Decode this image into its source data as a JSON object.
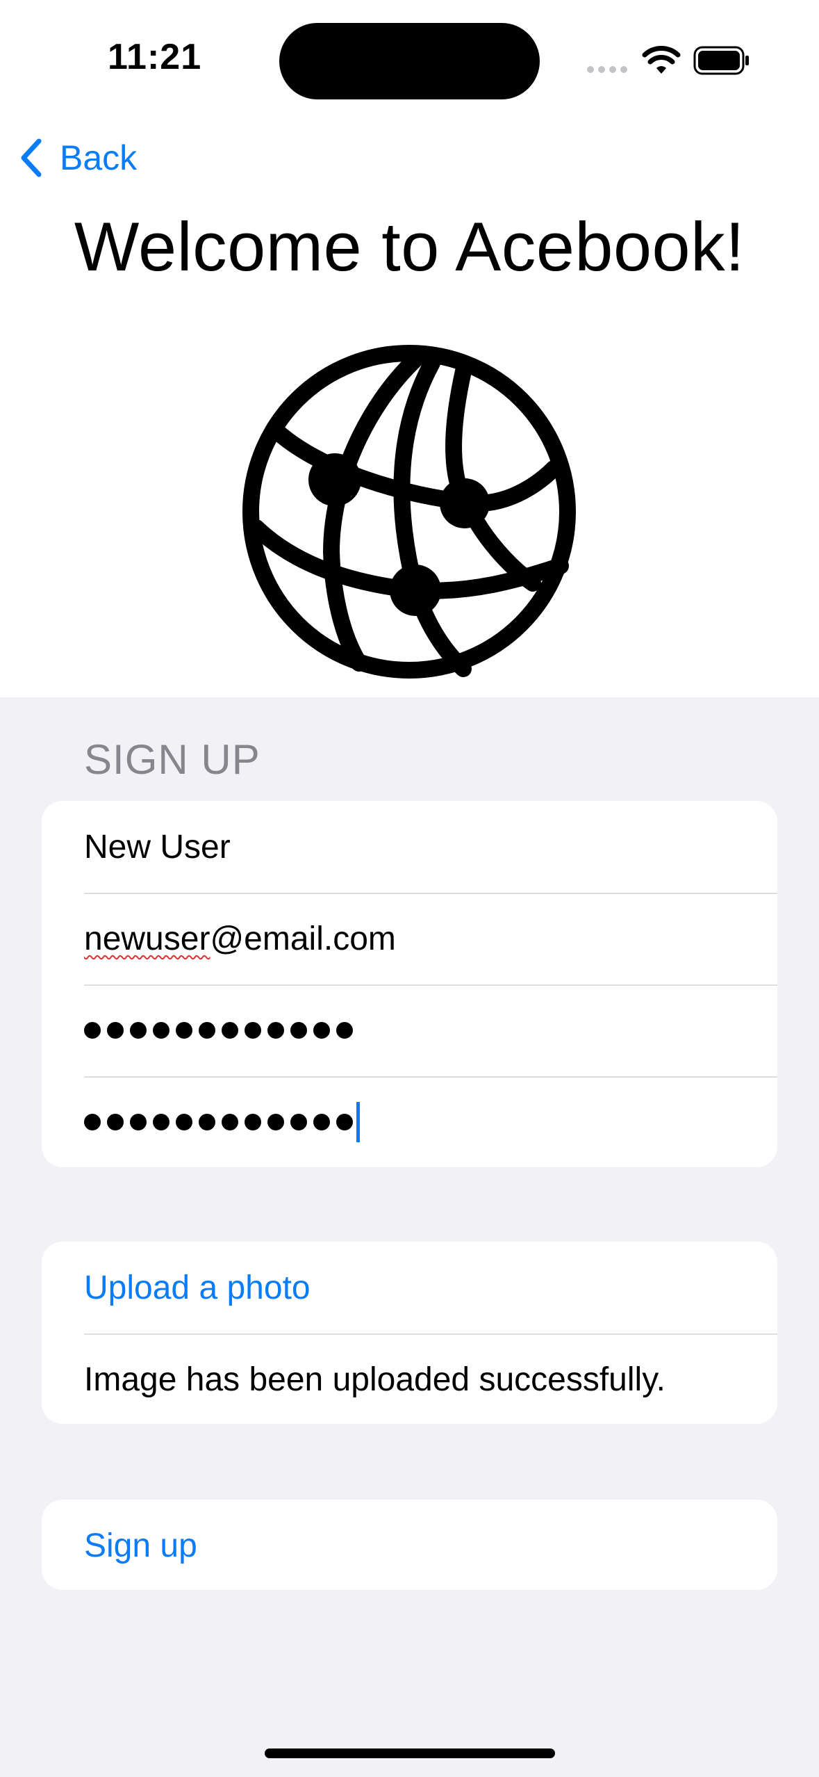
{
  "status_bar": {
    "time": "11:21"
  },
  "nav": {
    "back_label": "Back"
  },
  "header": {
    "title": "Welcome to Acebook!"
  },
  "icons": {
    "logo": "globe-icon",
    "back": "chevron-left-icon"
  },
  "form": {
    "section_title": "SIGN UP",
    "username_value": "New User",
    "email_value_underlined": "newuser",
    "email_value_rest": "@email.com",
    "password_masked_length": 12,
    "confirm_masked_length": 12
  },
  "upload": {
    "button_label": "Upload a photo",
    "status_text": "Image has been uploaded successfully."
  },
  "submit": {
    "label": "Sign up"
  },
  "colors": {
    "accent": "#0a7cf5",
    "background": "#f1f1f6",
    "card": "#ffffff"
  }
}
